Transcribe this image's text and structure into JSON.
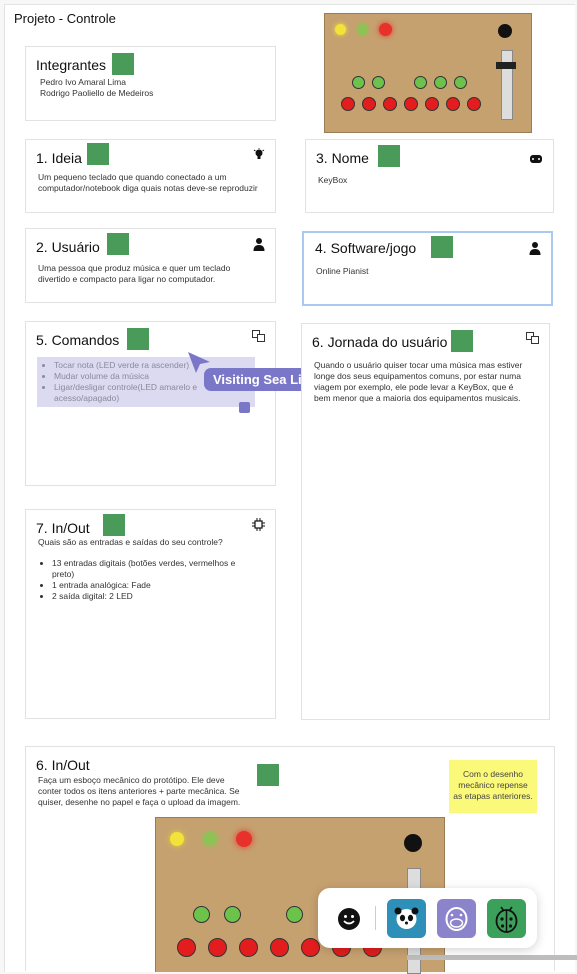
{
  "page_title": "Projeto  - Controle",
  "cards": {
    "integrantes": {
      "title": "Integrantes",
      "lines": [
        "Pedro Ivo Amaral Lima",
        "Rodrigo Paoliello de Medeiros"
      ]
    },
    "ideia": {
      "title": "1. Ideia",
      "text": "Um pequeno teclado que quando conectado a um computador/notebook diga quais notas deve-se reproduzir",
      "icon": "lightbulb-icon"
    },
    "nome": {
      "title": "3. Nome",
      "text": "KeyBox",
      "icon": "gamepad-icon"
    },
    "usuario": {
      "title": "2. Usuário",
      "text": "Uma pessoa que produz música e quer um teclado divertido e compacto para ligar no computador.",
      "icon": "user-icon"
    },
    "software": {
      "title": "4. Software/jogo",
      "text": "Online Pianist",
      "icon": "user-icon"
    },
    "comandos": {
      "title": "5. Comandos",
      "items": [
        "Tocar nota (LED verde ra ascender)",
        "Mudar volume da música",
        "Ligar/desligar controle(LED amarelo e acesso/apagado)"
      ],
      "icon": "translate-icon"
    },
    "jornada": {
      "title": "6. Jornada do usuário",
      "text": "Quando o usuário quiser tocar uma música mas estiver longe dos seus equipamentos comuns, por estar numa viagem por exemplo, ele pode levar a KeyBox, que é bem menor que a maioria dos equipamentos musicais.",
      "icon": "translate-icon"
    },
    "inout": {
      "title": "7. In/Out",
      "question": "Quais são as entradas e saídas do seu controle?",
      "items": [
        "13 entradas digitais (botões verdes, vermelhos e preto)",
        "1 entrada analógica: Fade",
        "2 saída digital: 2 LED"
      ],
      "icon": "chip-icon"
    },
    "esboco": {
      "title": "6. In/Out",
      "text": "Faça um esboço mecânico do protótipo. Ele deve conter todos os itens anteriores + parte mecânica. Se quiser, desenhe no papel e faça o upload da imagem."
    }
  },
  "sticky_note": "Com o desenho mecânico repense as etapas anteriores.",
  "visitor_label": "Visiting Sea Lion",
  "toolbar": {
    "icons": [
      "smiley-icon",
      "panda-icon",
      "hippo-icon",
      "ladybug-icon"
    ]
  },
  "colors": {
    "placeholder_square": "#4a9a5a",
    "visitor": "#7b77c8",
    "sticky": "#fbf97a",
    "board": "#c6a170"
  }
}
